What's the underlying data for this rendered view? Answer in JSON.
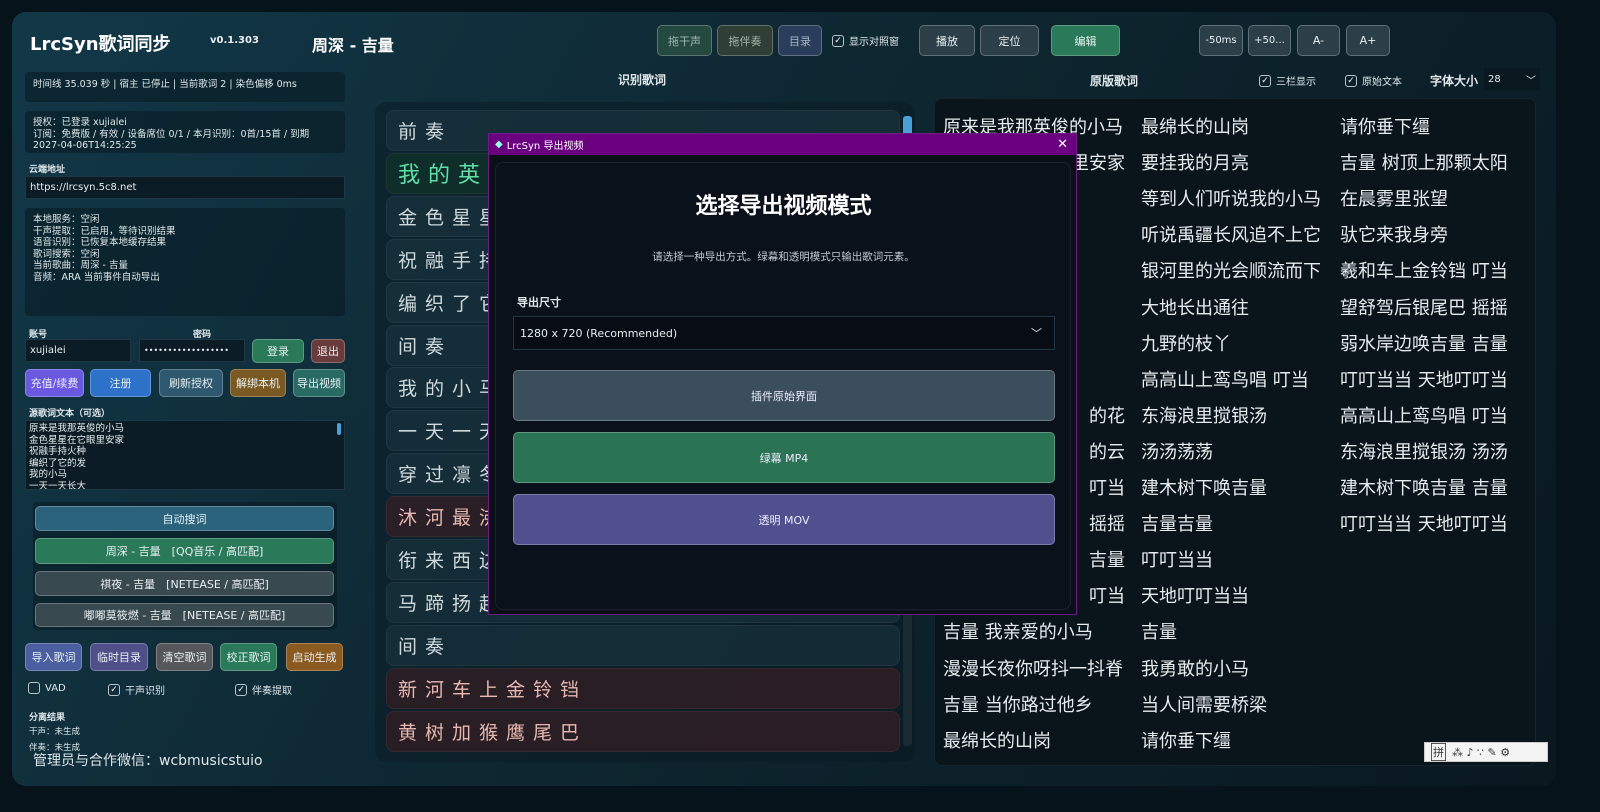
{
  "app": {
    "title": "LrcSyn歌词同步",
    "version": "v0.1.303",
    "song": "周深 - 吉量"
  },
  "toolbar": {
    "vocal": "拖干声",
    "accomp": "拖伴奏",
    "dir": "目录",
    "show_compare": "显示对照窗",
    "play": "播放",
    "locate": "定位",
    "edit": "编辑",
    "minus50": "-50ms",
    "plus50": "+50...",
    "font_minus": "A-",
    "font_plus": "A+"
  },
  "status": {
    "line": "时间线 35.039 秒 | 宿主 已停止 | 当前歌词 2 | 染色偏移 0ms"
  },
  "auth": {
    "l1": "授权：已登录 xujialei",
    "l2": "订阅：免费版 / 有效 / 设备席位 0/1 / 本月识别：0首/15首 / 到期",
    "l3": "2027-04-06T14:25:25"
  },
  "cloud": {
    "label": "云端地址",
    "value": "https://lrcsyn.5c8.net"
  },
  "service": [
    "本地服务：空闲",
    "干声提取：已启用，等待识别结果",
    "语音识别：已恢复本地缓存结果",
    "歌词搜索：空闲",
    "当前歌曲：周深 - 吉量",
    "音频：ARA 当前事件自动导出"
  ],
  "login": {
    "account_label": "账号",
    "account": "xujialei",
    "password_label": "密码",
    "password": "••••••••••••••••••",
    "login": "登录",
    "logout": "退出"
  },
  "actions": {
    "recharge": "充值/续费",
    "register": "注册",
    "refresh": "刷新授权",
    "unbind": "解绑本机",
    "export": "导出视频"
  },
  "source": {
    "label": "源歌词文本（可选）",
    "lines": [
      "原来是我那英俊的小马",
      "金色星星在它眼里安家",
      "祝融手持火种",
      "编织了它的发",
      "我的小马",
      "一天一天长大"
    ]
  },
  "search": {
    "auto": "自动搜词",
    "results": [
      "周深 - 吉量　[QQ音乐 / 高匹配]",
      "祺夜 - 吉量　[NETEASE / 高匹配]",
      "嘟嘟莫筱燃 - 吉量　[NETEASE / 高匹配]"
    ]
  },
  "bottom": {
    "import": "导入歌词",
    "temp": "临时目录",
    "clear": "清空歌词",
    "correct": "校正歌词",
    "generate": "启动生成",
    "vad": "VAD",
    "vocal_rec": "干声识别",
    "accomp_ext": "伴奏提取",
    "sep_label": "分离结果",
    "sep_vocal": "干声：未生成",
    "sep_accomp": "伴奏：未生成",
    "contact": "管理员与合作微信：wcbmusicstuio"
  },
  "recognized": {
    "title": "识别歌词",
    "rows": [
      {
        "text": "前奏",
        "state": "normal"
      },
      {
        "text": "我的英",
        "state": "current"
      },
      {
        "text": "金色星星",
        "state": "normal"
      },
      {
        "text": "祝融手持",
        "state": "normal"
      },
      {
        "text": "编织了它",
        "state": "normal"
      },
      {
        "text": "间奏",
        "state": "normal"
      },
      {
        "text": "我的小马",
        "state": "normal"
      },
      {
        "text": "一天一天",
        "state": "normal"
      },
      {
        "text": "穿过凛冬",
        "state": "normal"
      },
      {
        "text": "沐河最沸",
        "state": "warn"
      },
      {
        "text": "衔来西边",
        "state": "normal"
      },
      {
        "text": "马蹄扬起",
        "state": "normal"
      },
      {
        "text": "间奏",
        "state": "normal"
      },
      {
        "text": "新河车上金铃铛",
        "state": "warn"
      },
      {
        "text": "黄树加猴鹰尾巴",
        "state": "warn"
      }
    ]
  },
  "original": {
    "title": "原版歌词",
    "three_col": "三栏显示",
    "raw_text": "原始文本",
    "font_label": "字体大小",
    "font_size": "28",
    "col1": [
      "原来是我那英俊的小马",
      "里安家",
      "",
      "",
      "",
      "",
      "",
      "",
      "的花",
      "的云",
      "叮当",
      "摇摇",
      "吉量",
      "叮当",
      "吉量 我亲爱的小马",
      "漫漫长夜你呀抖一抖脊",
      "吉量 当你路过他乡",
      "最绵长的山岗"
    ],
    "col2": [
      "最绵长的山岗",
      "要挂我的月亮",
      "等到人们听说我的小马",
      "听说禹疆长风追不上它",
      "银河里的光会顺流而下",
      "大地长出通往",
      "九野的枝丫",
      "高高山上鸾鸟唱 叮当",
      "东海浪里搅银汤",
      "汤汤荡荡",
      "建木树下唤吉量",
      "吉量吉量",
      "叮叮当当",
      "天地叮叮当当",
      "吉量",
      "我勇敢的小马",
      "当人间需要桥梁",
      "请你垂下缰"
    ],
    "col3": [
      "请你垂下缰",
      "吉量 树顶上那颗太阳",
      "在晨雾里张望",
      "驮它来我身旁",
      "羲和车上金铃铛 叮当",
      "望舒驾后银尾巴 摇摇",
      "弱水岸边唤吉量 吉量",
      "叮叮当当 天地叮叮当",
      "高高山上鸾鸟唱 叮当",
      "东海浪里搅银汤 汤汤",
      "建木树下唤吉量 吉量",
      "叮叮当当 天地叮叮当"
    ]
  },
  "modal": {
    "window_title": "LrcSyn 导出视频",
    "heading": "选择导出视频模式",
    "desc": "请选择一种导出方式。绿幕和透明模式只输出歌词元素。",
    "size_label": "导出尺寸",
    "size_value": "1280 x 720 (Recommended)",
    "opt_plugin": "插件原始界面",
    "opt_green": "绿幕 MP4",
    "opt_alpha": "透明 MOV"
  },
  "ime": {
    "mode": "拼"
  },
  "colors": {
    "modal_bar": "#6a0080",
    "green": "#2a7a5a",
    "purple": "#524f8e",
    "current_lyric": "#5fe0a8"
  }
}
